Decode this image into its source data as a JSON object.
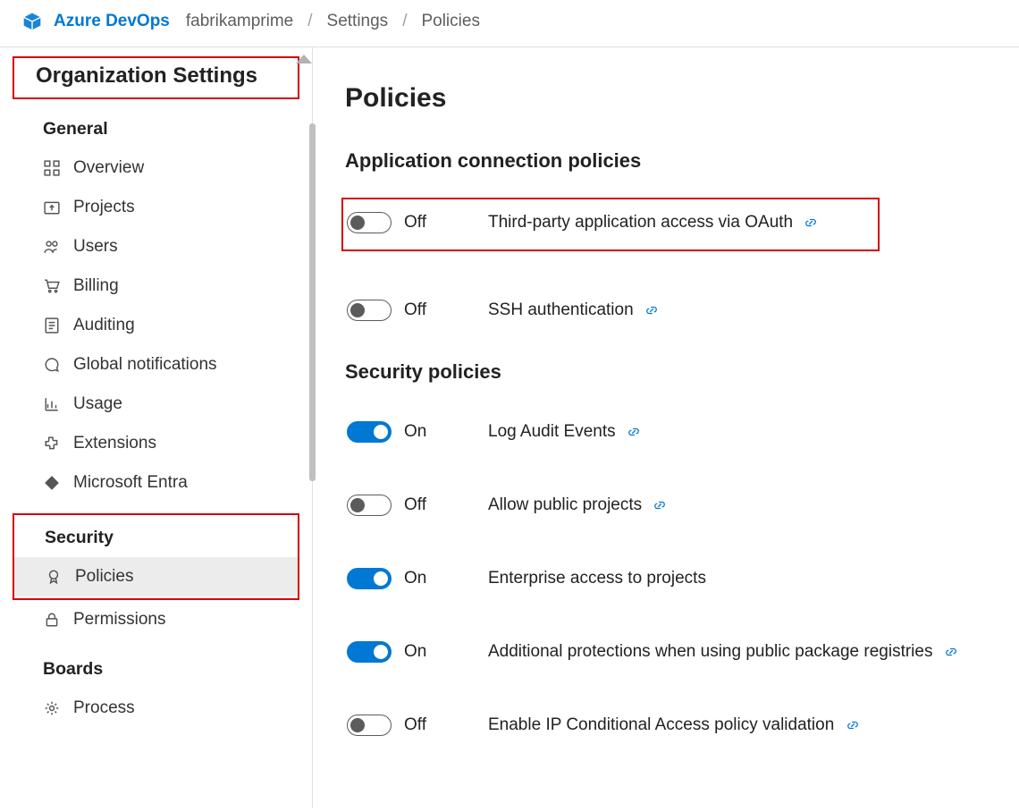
{
  "header": {
    "product": "Azure DevOps",
    "breadcrumb": [
      "fabrikamprime",
      "Settings",
      "Policies"
    ]
  },
  "sidebar": {
    "title": "Organization Settings",
    "groups": [
      {
        "label": "General",
        "items": [
          {
            "label": "Overview",
            "icon": "grid-icon"
          },
          {
            "label": "Projects",
            "icon": "upload-icon"
          },
          {
            "label": "Users",
            "icon": "users-icon"
          },
          {
            "label": "Billing",
            "icon": "cart-icon"
          },
          {
            "label": "Auditing",
            "icon": "list-icon"
          },
          {
            "label": "Global notifications",
            "icon": "chat-icon"
          },
          {
            "label": "Usage",
            "icon": "chart-icon"
          },
          {
            "label": "Extensions",
            "icon": "puzzle-icon"
          },
          {
            "label": "Microsoft Entra",
            "icon": "diamond-icon"
          }
        ]
      },
      {
        "label": "Security",
        "items": [
          {
            "label": "Policies",
            "icon": "badge-icon",
            "selected": true
          },
          {
            "label": "Permissions",
            "icon": "lock-icon"
          }
        ]
      },
      {
        "label": "Boards",
        "items": [
          {
            "label": "Process",
            "icon": "gear-icon"
          }
        ]
      }
    ]
  },
  "main": {
    "title": "Policies",
    "groups": [
      {
        "label": "Application connection policies",
        "policies": [
          {
            "on": false,
            "state": "Off",
            "label": "Third-party application access via OAuth",
            "link": true,
            "highlight": true
          },
          {
            "on": false,
            "state": "Off",
            "label": "SSH authentication",
            "link": true
          }
        ]
      },
      {
        "label": "Security policies",
        "policies": [
          {
            "on": true,
            "state": "On",
            "label": "Log Audit Events",
            "link": true
          },
          {
            "on": false,
            "state": "Off",
            "label": "Allow public projects",
            "link": true
          },
          {
            "on": true,
            "state": "On",
            "label": "Enterprise access to projects",
            "link": false
          },
          {
            "on": true,
            "state": "On",
            "label": "Additional protections when using public package registries",
            "link": true
          },
          {
            "on": false,
            "state": "Off",
            "label": "Enable IP Conditional Access policy validation",
            "link": true
          }
        ]
      }
    ]
  }
}
